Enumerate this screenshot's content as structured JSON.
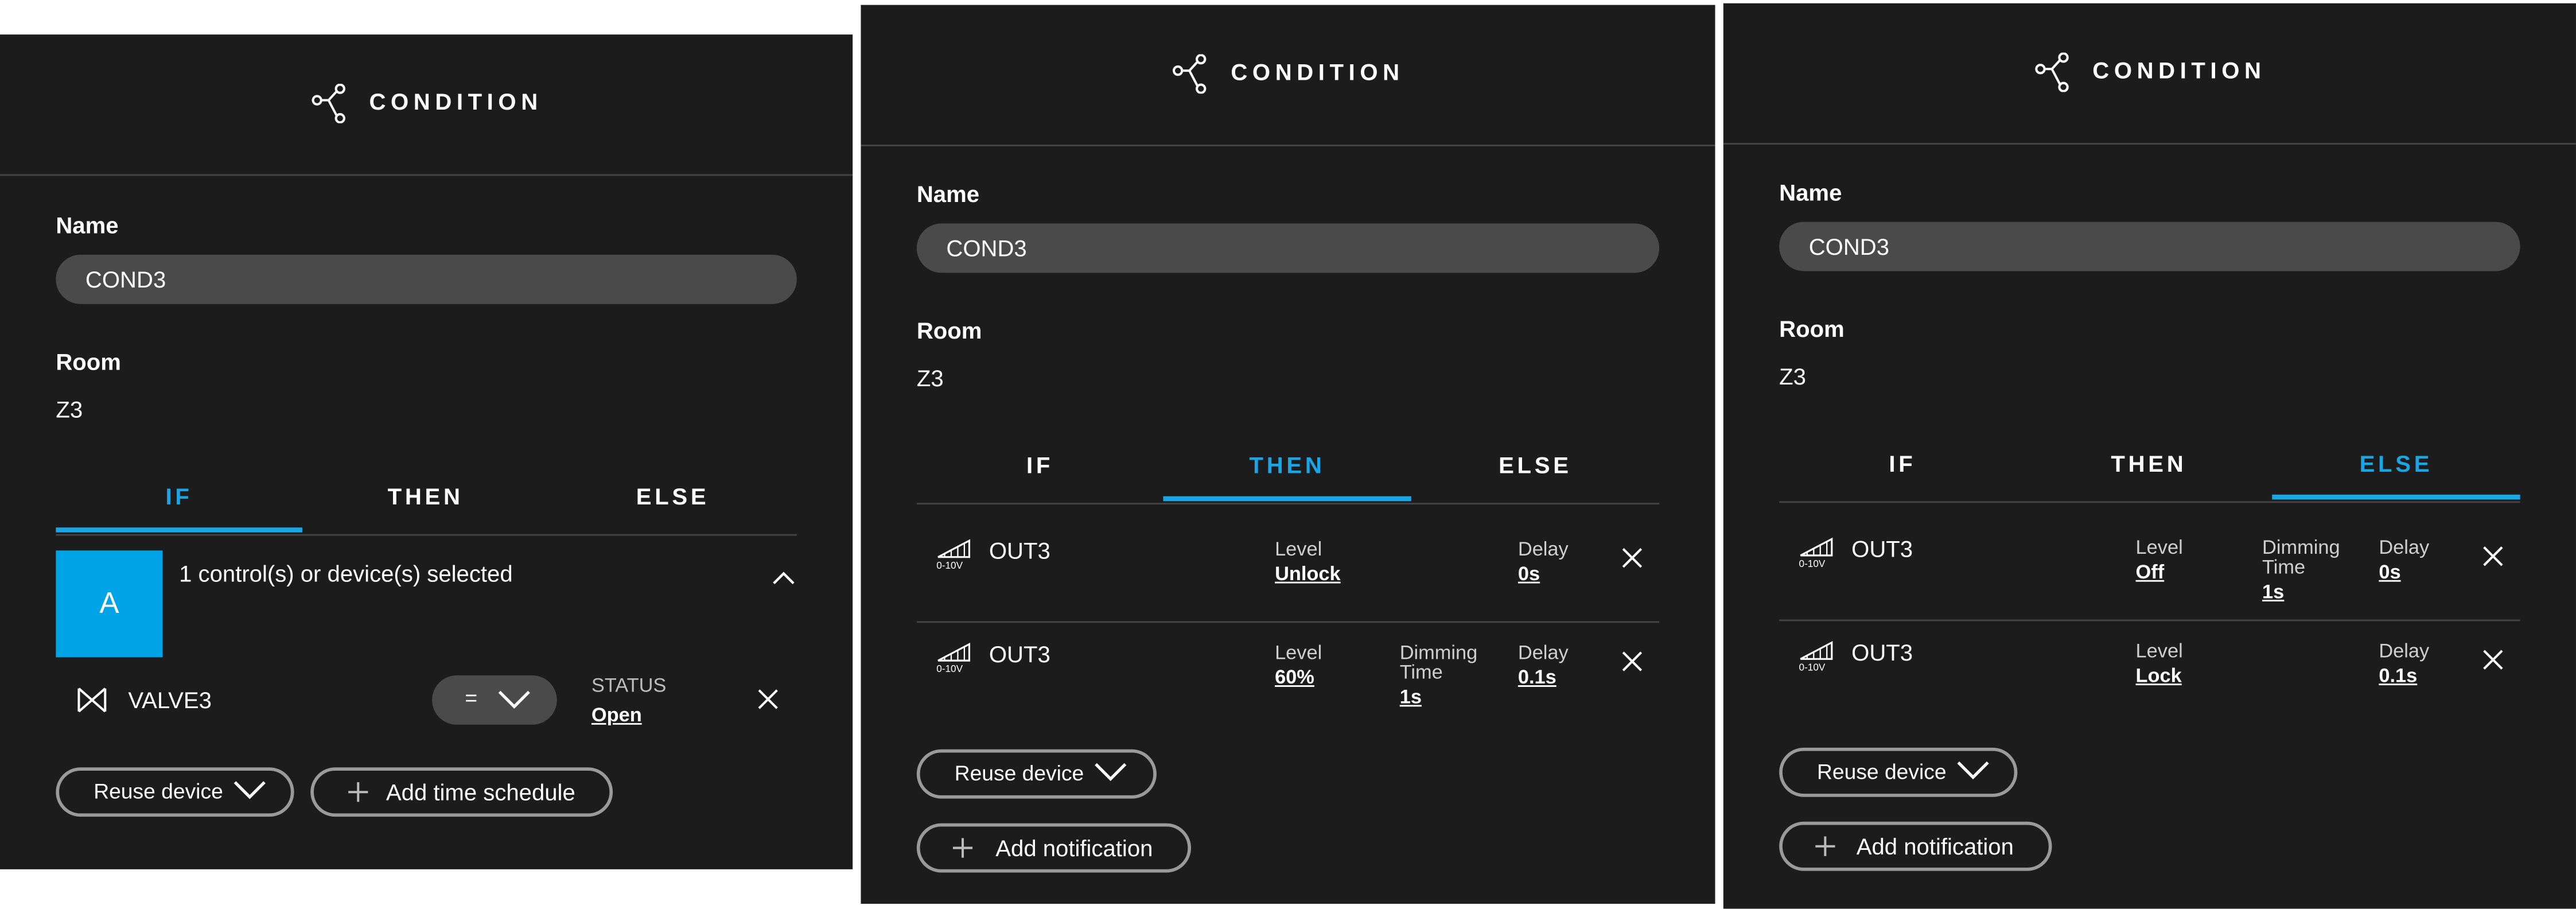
{
  "panels": [
    {
      "header": {
        "title": "CONDITION",
        "icon": "share-nodes-icon"
      },
      "name": {
        "label": "Name",
        "value": "COND3"
      },
      "room": {
        "label": "Room",
        "value": "Z3"
      },
      "tabs": [
        "IF",
        "THEN",
        "ELSE"
      ],
      "active_tab": "IF",
      "selection": {
        "badge": "A",
        "text": "1 control(s) or device(s) selected",
        "badge_color": "#00a3e6"
      },
      "device": {
        "icon": "valve-icon",
        "name": "VALVE3",
        "operator": "=",
        "status_label": "STATUS",
        "status_value": "Open"
      },
      "buttons": {
        "reuse": "Reuse device",
        "add": "Add time schedule"
      }
    },
    {
      "header": {
        "title": "CONDITION",
        "icon": "share-nodes-icon"
      },
      "name": {
        "label": "Name",
        "value": "COND3"
      },
      "room": {
        "label": "Room",
        "value": "Z3"
      },
      "tabs": [
        "IF",
        "THEN",
        "ELSE"
      ],
      "active_tab": "THEN",
      "rows": [
        {
          "icon_text": "0-10V",
          "name": "OUT3",
          "level_label": "Level",
          "level": "Unlock",
          "dimming_label": "",
          "dimming": "",
          "delay_label": "Delay",
          "delay": "0s"
        },
        {
          "icon_text": "0-10V",
          "name": "OUT3",
          "level_label": "Level",
          "level": "60%",
          "dimming_label": "Dimming Time",
          "dimming": "1s",
          "delay_label": "Delay",
          "delay": "0.1s"
        }
      ],
      "buttons": {
        "reuse": "Reuse device",
        "add": "Add notification"
      }
    },
    {
      "header": {
        "title": "CONDITION",
        "icon": "share-nodes-icon"
      },
      "name": {
        "label": "Name",
        "value": "COND3"
      },
      "room": {
        "label": "Room",
        "value": "Z3"
      },
      "tabs": [
        "IF",
        "THEN",
        "ELSE"
      ],
      "active_tab": "ELSE",
      "rows": [
        {
          "icon_text": "0-10V",
          "name": "OUT3",
          "level_label": "Level",
          "level": "Off",
          "dimming_label": "Dimming Time",
          "dimming": "1s",
          "delay_label": "Delay",
          "delay": "0s"
        },
        {
          "icon_text": "0-10V",
          "name": "OUT3",
          "level_label": "Level",
          "level": "Lock",
          "dimming_label": "",
          "dimming": "",
          "delay_label": "Delay",
          "delay": "0.1s"
        }
      ],
      "buttons": {
        "reuse": "Reuse device",
        "add": "Add notification"
      }
    }
  ],
  "colors": {
    "accent": "#1aa6e4",
    "panel_bg": "#1c1c1c",
    "field_bg": "#4a4a4a"
  }
}
